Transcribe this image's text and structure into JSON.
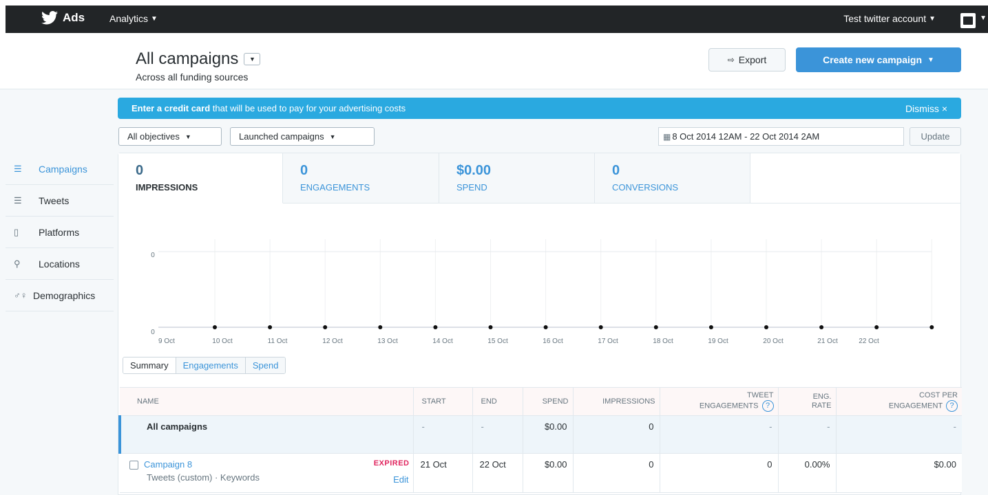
{
  "nav": {
    "brand": "Ads",
    "analytics_label": "Analytics",
    "account_label": "Test twitter account"
  },
  "header": {
    "title": "All campaigns",
    "subtitle": "Across all funding sources",
    "export_label": "Export",
    "create_label": "Create new campaign"
  },
  "banner": {
    "bold_text": "Enter a credit card",
    "text": " that will be used to pay for your advertising costs",
    "dismiss": "Dismiss ×"
  },
  "filters": {
    "objectives": "All objectives",
    "launched": "Launched campaigns",
    "date_range": "8 Oct 2014 12AM - 22 Oct 2014 2AM",
    "update": "Update"
  },
  "sidebar": {
    "items": [
      {
        "label": "Campaigns",
        "icon": "list-icon"
      },
      {
        "label": "Tweets",
        "icon": "list-icon"
      },
      {
        "label": "Platforms",
        "icon": "mobile-icon"
      },
      {
        "label": "Locations",
        "icon": "pin-icon"
      },
      {
        "label": "Demographics",
        "icon": "gender-icon"
      }
    ]
  },
  "metrics": [
    {
      "value": "0",
      "label": "IMPRESSIONS"
    },
    {
      "value": "0",
      "label": "ENGAGEMENTS"
    },
    {
      "value": "$0.00",
      "label": "SPEND"
    },
    {
      "value": "0",
      "label": "CONVERSIONS"
    }
  ],
  "chart_data": {
    "type": "line",
    "categories": [
      "9 Oct",
      "10 Oct",
      "11 Oct",
      "12 Oct",
      "13 Oct",
      "14 Oct",
      "15 Oct",
      "16 Oct",
      "17 Oct",
      "18 Oct",
      "19 Oct",
      "20 Oct",
      "21 Oct",
      "22 Oct"
    ],
    "points": 14,
    "values": [
      0,
      0,
      0,
      0,
      0,
      0,
      0,
      0,
      0,
      0,
      0,
      0,
      0,
      0
    ],
    "y_ticks": [
      "0",
      "0"
    ]
  },
  "chart_toggle": {
    "summary": "Summary",
    "engagements": "Engagements",
    "spend": "Spend"
  },
  "table": {
    "headers": {
      "name": "NAME",
      "start": "START",
      "end": "END",
      "spend": "SPEND",
      "impressions": "IMPRESSIONS",
      "tweet_eng_1": "TWEET",
      "tweet_eng_2": "ENGAGEMENTS",
      "eng_rate_1": "ENG.",
      "eng_rate_2": "RATE",
      "cpe_1": "COST PER",
      "cpe_2": "ENGAGEMENT",
      "help": "?"
    },
    "all_row": {
      "name": "All campaigns",
      "start": "-",
      "end": "-",
      "spend": "$0.00",
      "impressions": "0",
      "tweet_engagements": "-",
      "eng_rate": "-",
      "cost_per_engagement": "-"
    },
    "rows": [
      {
        "name": "Campaign 8",
        "sub": "Tweets (custom) · Keywords",
        "status": "EXPIRED",
        "edit": "Edit",
        "start": "21 Oct",
        "end": "22 Oct",
        "spend": "$0.00",
        "impressions": "0",
        "tweet_engagements": "0",
        "eng_rate": "0.00%",
        "cost_per_engagement": "$0.00"
      }
    ]
  }
}
